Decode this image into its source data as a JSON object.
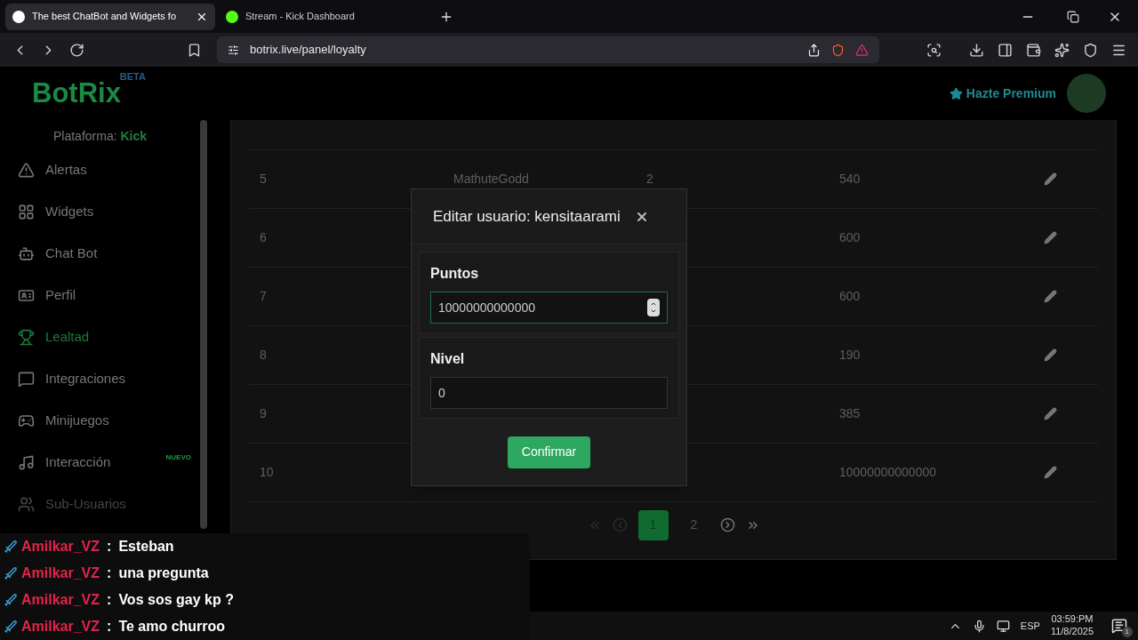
{
  "browser": {
    "tabs": [
      {
        "title": "The best ChatBot and Widgets fo",
        "selected": true
      },
      {
        "title": "Stream - Kick Dashboard",
        "selected": false
      }
    ],
    "url": "botrix.live/panel/loyalty"
  },
  "header": {
    "logo": "BotRix",
    "logo_badge": "BETA",
    "premium": "Hazte Premium"
  },
  "sidebar": {
    "platform_label": "Plataforma:",
    "platform": "Kick",
    "items": [
      {
        "label": "Alertas",
        "selected": false
      },
      {
        "label": "Widgets",
        "selected": false
      },
      {
        "label": "Chat Bot",
        "selected": false
      },
      {
        "label": "Perfil",
        "selected": false
      },
      {
        "label": "Lealtad",
        "selected": true
      },
      {
        "label": "Integraciones",
        "selected": false
      },
      {
        "label": "Minijuegos",
        "selected": false
      },
      {
        "label": "Interacción",
        "selected": false,
        "badge": "NUEVO"
      },
      {
        "label": "Sub-Usuarios",
        "selected": false
      }
    ]
  },
  "table": {
    "rows": [
      {
        "number": "5",
        "name": "MathuteGodd",
        "level": "2",
        "points": "540"
      },
      {
        "number": "6",
        "points": "600"
      },
      {
        "number": "7",
        "points": "600"
      },
      {
        "number": "8",
        "points": "190"
      },
      {
        "number": "9",
        "points": "385"
      },
      {
        "number": "10",
        "points": "10000000000000"
      }
    ]
  },
  "pagination": {
    "prev_disabled": true,
    "next_disabled": false,
    "pages": [
      {
        "label": "1",
        "selected": true
      },
      {
        "label": "2",
        "selected": false
      }
    ]
  },
  "modal": {
    "title": "Editar usuario: kensitaarami",
    "fields": [
      {
        "label": "Puntos",
        "value": "10000000000000",
        "kind": "number",
        "focused": true
      },
      {
        "label": "Nivel",
        "value": "0",
        "kind": "text",
        "focused": false
      }
    ],
    "button": "Confirmar"
  },
  "chat": {
    "messages": [
      {
        "user": "Amilkar_VZ",
        "separator": ":",
        "text": "Esteban"
      },
      {
        "user": "Amilkar_VZ",
        "separator": ":",
        "text": "una pregunta"
      },
      {
        "user": "Amilkar_VZ",
        "separator": ":",
        "text": "Vos sos gay kp ?"
      },
      {
        "user": "Amilkar_VZ",
        "separator": ":",
        "text": "Te amo churroo"
      }
    ]
  },
  "taskbar": {
    "language": "ESP",
    "time": "03:59:PM",
    "date": "11/8/2025",
    "notifications": "1"
  }
}
